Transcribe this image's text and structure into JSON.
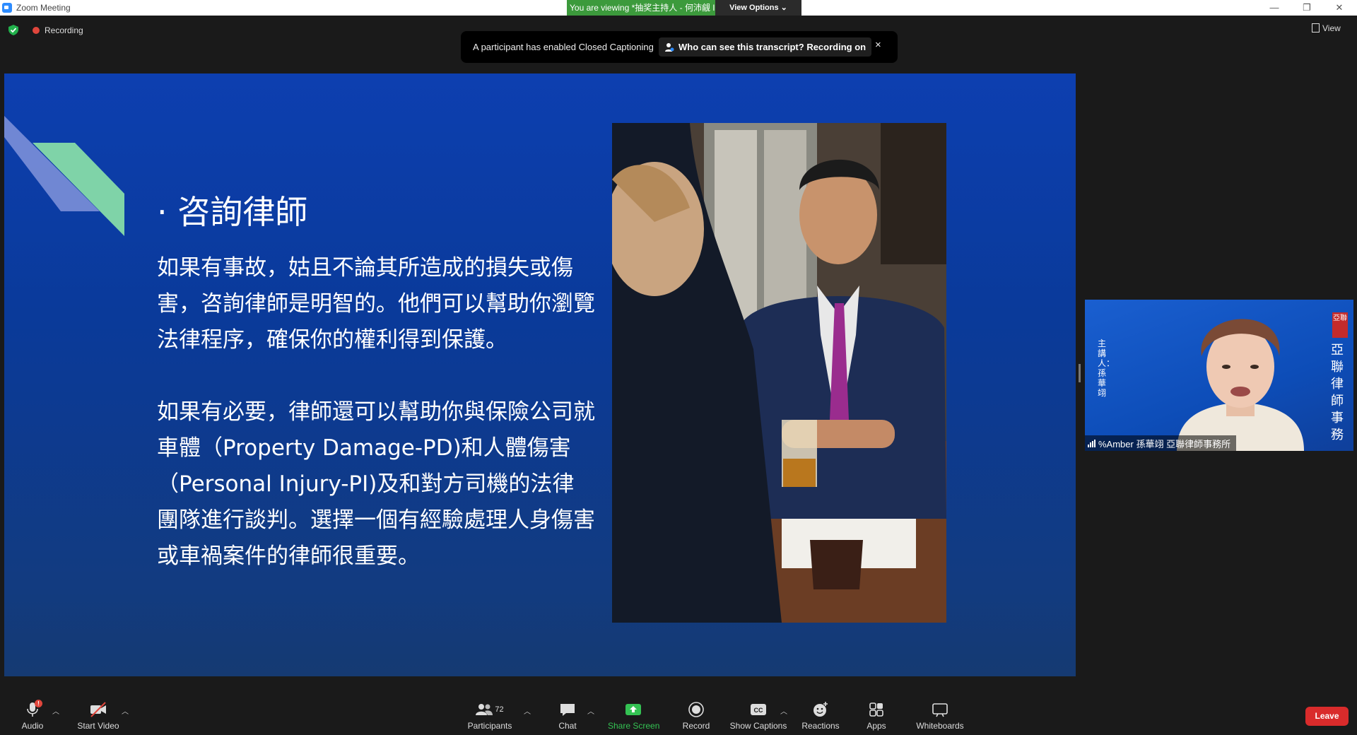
{
  "window": {
    "title": "Zoom Meeting",
    "viewing_banner": "You are viewing *抽奖主持人 - 何沛觎 Iris Ho's screen",
    "view_options": "View Options"
  },
  "top": {
    "recording_label": "Recording",
    "view_label": "View"
  },
  "caption_notice": {
    "message": "A participant has enabled Closed Captioning",
    "link": "Who can see this transcript? Recording on",
    "close": "×"
  },
  "slide": {
    "title": "· 咨詢律師",
    "paragraph1": "如果有事故，姑且不論其所造成的損失或傷害，咨詢律師是明智的。他們可以幫助你瀏覽法律程序，確保你的權利得到保護。",
    "paragraph2": "如果有必要，律師還可以幫助你與保險公司就車體（Property Damage-PD)和人體傷害（Personal Injury-PI)及和對方司機的法律團隊進行談判。選擇一個有經驗處理人身傷害或車禍案件的律師很重要。"
  },
  "participant": {
    "name": "%Amber 孫華翊 亞聯律師事務所",
    "side_left": "主講人：孫華翊",
    "side_right": "亞聯律師事務",
    "seal": "亞聯"
  },
  "toolbar": {
    "audio": "Audio",
    "audio_badge": "!",
    "start_video": "Start Video",
    "participants": "Participants",
    "participants_count": "72",
    "chat": "Chat",
    "share_screen": "Share Screen",
    "record": "Record",
    "show_captions": "Show Captions",
    "reactions": "Reactions",
    "apps": "Apps",
    "whiteboards": "Whiteboards",
    "leave": "Leave"
  },
  "colors": {
    "slide_blue": "#0d3fb0",
    "share_green": "#34c253",
    "leave_red": "#d92b2b",
    "banner_green": "#3c9a3c"
  }
}
